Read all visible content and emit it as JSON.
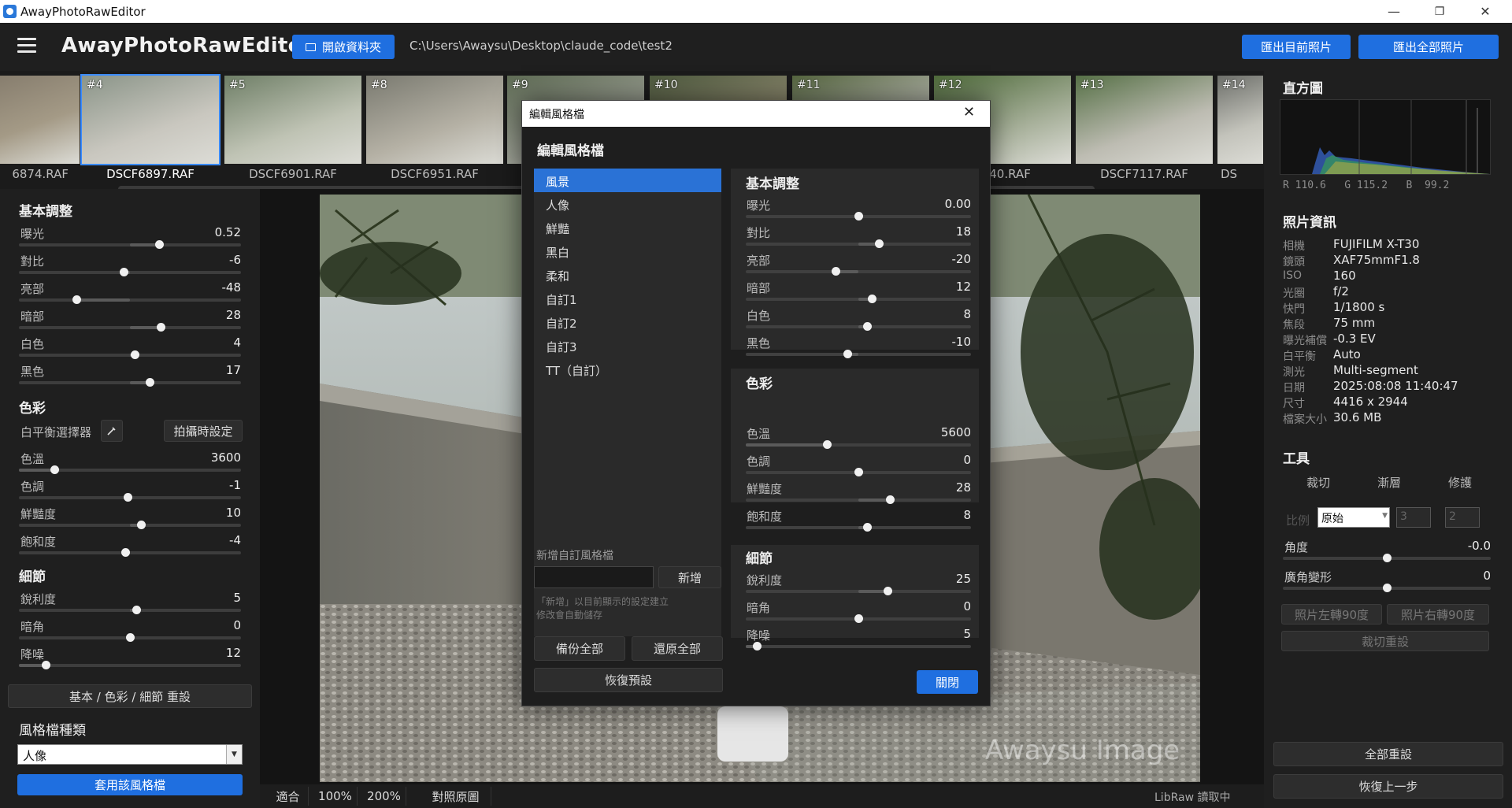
{
  "window": {
    "title": "AwayPhotoRawEditor",
    "min": "—",
    "max": "❐",
    "close": "✕"
  },
  "header": {
    "app_title": "AwayPhotoRawEditor",
    "open_folder": "開啟資料夾",
    "path": "C:\\Users\\Awaysu\\Desktop\\claude_code\\test2",
    "export_current": "匯出目前照片",
    "export_all": "匯出全部照片"
  },
  "filmstrip": [
    {
      "num": "",
      "name": "6874.RAF",
      "selected": false
    },
    {
      "num": "#4",
      "name": "DSCF6897.RAF",
      "selected": true
    },
    {
      "num": "#5",
      "name": "DSCF6901.RAF",
      "selected": false
    },
    {
      "num": "#8",
      "name": "DSCF6951.RAF",
      "selected": false
    },
    {
      "num": "#9",
      "name": "",
      "selected": false
    },
    {
      "num": "#10",
      "name": "",
      "selected": false
    },
    {
      "num": "#11",
      "name": "",
      "selected": false
    },
    {
      "num": "#12",
      "name": "7040.RAF",
      "selected": false
    },
    {
      "num": "#13",
      "name": "DSCF7117.RAF",
      "selected": false
    },
    {
      "num": "#14",
      "name": "DS",
      "selected": false
    }
  ],
  "left": {
    "basic_title": "基本調整",
    "basic": [
      {
        "label": "曝光",
        "value": "0.52",
        "pos": 0.63,
        "from": 0.5
      },
      {
        "label": "對比",
        "value": "-6",
        "pos": 0.47,
        "from": 0.5
      },
      {
        "label": "亮部",
        "value": "-48",
        "pos": 0.26,
        "from": 0.5
      },
      {
        "label": "暗部",
        "value": "28",
        "pos": 0.64,
        "from": 0.5
      },
      {
        "label": "白色",
        "value": "4",
        "pos": 0.52,
        "from": 0.5
      },
      {
        "label": "黑色",
        "value": "17",
        "pos": 0.59,
        "from": 0.5
      }
    ],
    "color_title": "色彩",
    "wb_picker": "白平衡選擇器",
    "as_shot": "拍攝時設定",
    "color": [
      {
        "label": "色溫",
        "value": "3600",
        "pos": 0.16,
        "from": 0.0
      },
      {
        "label": "色調",
        "value": "-1",
        "pos": 0.49,
        "from": 0.5
      },
      {
        "label": "鮮豔度",
        "value": "10",
        "pos": 0.55,
        "from": 0.5
      },
      {
        "label": "飽和度",
        "value": "-4",
        "pos": 0.48,
        "from": 0.5
      }
    ],
    "detail_title": "細節",
    "detail": [
      {
        "label": "銳利度",
        "value": "5",
        "pos": 0.53,
        "from": 0.5
      },
      {
        "label": "暗角",
        "value": "0",
        "pos": 0.5,
        "from": 0.5
      },
      {
        "label": "降噪",
        "value": "12",
        "pos": 0.12,
        "from": 0.0
      }
    ],
    "reset_btn": "基本 / 色彩 / 細節 重設",
    "profile_title": "風格檔種類",
    "profile_value": "人像",
    "apply_btn": "套用該風格檔"
  },
  "bottom": {
    "fit": "適合",
    "z100": "100%",
    "z200": "200%",
    "compare": "對照原圖",
    "status": "LibRaw 讀取中"
  },
  "photo": {
    "watermark": "Awaysu Image"
  },
  "right": {
    "histogram_title": "直方圖",
    "rgb": "R 110.6   G 115.2   B  99.2",
    "info_title": "照片資訊",
    "info": [
      {
        "k": "相機",
        "v": "FUJIFILM X-T30"
      },
      {
        "k": "鏡頭",
        "v": "XAF75mmF1.8"
      },
      {
        "k": "ISO",
        "v": "160"
      },
      {
        "k": "光圈",
        "v": "f/2"
      },
      {
        "k": "快門",
        "v": "1/1800 s"
      },
      {
        "k": "焦段",
        "v": "75 mm"
      },
      {
        "k": "曝光補償",
        "v": "-0.3 EV"
      },
      {
        "k": "白平衡",
        "v": "Auto"
      },
      {
        "k": "測光",
        "v": "Multi-segment"
      },
      {
        "k": "日期",
        "v": "2025:08:08 11:40:47"
      },
      {
        "k": "尺寸",
        "v": "4416 x 2944"
      },
      {
        "k": "檔案大小",
        "v": "30.6 MB"
      }
    ],
    "tools_title": "工具",
    "tabs": [
      "裁切",
      "漸層",
      "修護"
    ],
    "ratio_label": "比例",
    "ratio_value": "原始",
    "ratio_w": "3",
    "ratio_h": "2",
    "angle_label": "角度",
    "angle_value": "-0.0",
    "wide_label": "廣角變形",
    "wide_value": "0",
    "rot_left": "照片左轉90度",
    "rot_right": "照片右轉90度",
    "crop_reset": "裁切重設",
    "reset_all": "全部重設",
    "undo": "恢復上一步"
  },
  "dialog": {
    "title": "編輯風格檔",
    "heading": "編輯風格檔",
    "close": "✕",
    "profiles": [
      "風景",
      "人像",
      "鮮豔",
      "黑白",
      "柔和",
      "自訂1",
      "自訂2",
      "自訂3",
      "TT（自訂）"
    ],
    "new_label": "新增自訂風格檔",
    "new_btn": "新增",
    "hint1": "「新增」以目前顯示的設定建立",
    "hint2": "修改會自動儲存",
    "backup_all": "備份全部",
    "restore_all": "還原全部",
    "restore_default": "恢復預設",
    "close_btn": "關閉",
    "basic_title": "基本調整",
    "basic": [
      {
        "label": "曝光",
        "value": "0.00",
        "pos": 0.5
      },
      {
        "label": "對比",
        "value": "18",
        "pos": 0.59
      },
      {
        "label": "亮部",
        "value": "-20",
        "pos": 0.4
      },
      {
        "label": "暗部",
        "value": "12",
        "pos": 0.56
      },
      {
        "label": "白色",
        "value": "8",
        "pos": 0.54
      },
      {
        "label": "黑色",
        "value": "-10",
        "pos": 0.45
      }
    ],
    "color_title": "色彩",
    "color": [
      {
        "label": "色溫",
        "value": "5600",
        "pos": 0.36,
        "from": 0.0
      },
      {
        "label": "色調",
        "value": "0",
        "pos": 0.5
      },
      {
        "label": "鮮豔度",
        "value": "28",
        "pos": 0.64
      },
      {
        "label": "飽和度",
        "value": "8",
        "pos": 0.54
      }
    ],
    "detail_title": "細節",
    "detail": [
      {
        "label": "銳利度",
        "value": "25",
        "pos": 0.63
      },
      {
        "label": "暗角",
        "value": "0",
        "pos": 0.5
      },
      {
        "label": "降噪",
        "value": "5",
        "pos": 0.05,
        "from": 0.0
      }
    ]
  }
}
